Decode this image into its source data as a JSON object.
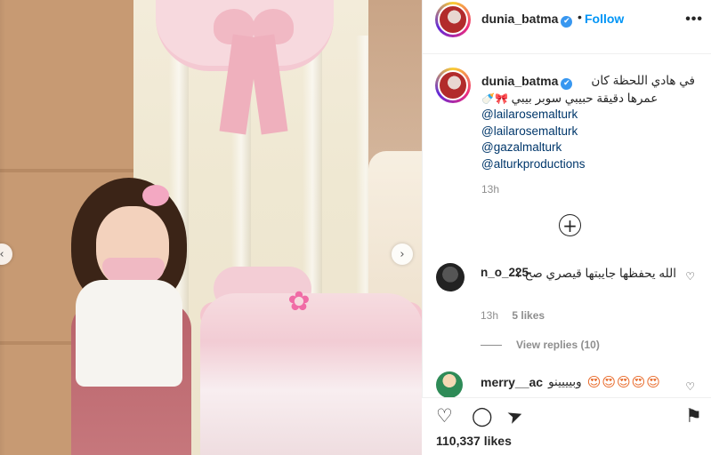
{
  "header": {
    "username": "dunia_batma",
    "verified_glyph": "✔",
    "separator": "•",
    "follow_label": "Follow",
    "more_label": "•••"
  },
  "photo": {
    "sticker_glyph": "✿",
    "prev_glyph": "‹",
    "next_glyph": "›"
  },
  "caption": {
    "username": "dunia_batma",
    "text_line1": "في هادي اللحظة كان",
    "text_line2": "عمرها دقيقة حبيبي سوبر بيبي",
    "emoji": "🎀🍼",
    "mentions": [
      "@lailarosemalturk",
      "@lailarosemalturk",
      "@gazalmalturk",
      "@alturkproductions"
    ],
    "time": "13h"
  },
  "add_comment_glyph": "+",
  "comments": [
    {
      "username": "n_o_225",
      "text": "الله يحفظها جايبتها قيصري صح ؟",
      "time": "13h",
      "likes": "5 likes",
      "heart_glyph": "♡"
    },
    {
      "username": "merry__ac",
      "text": "وبيييينو",
      "emoji": "😍😍😍😍😍",
      "heart_glyph": "♡"
    }
  ],
  "view_replies": "View replies (10)",
  "actions": {
    "like_glyph": "♡",
    "comment_glyph": "◯",
    "share_glyph": "➤",
    "save_glyph": "⚑",
    "likes_total": "110,337 likes"
  },
  "colors": {
    "accent": "#0095f6",
    "text": "#262626",
    "muted": "#8e8e8e",
    "link": "#00376b",
    "verified": "#3897f0"
  }
}
